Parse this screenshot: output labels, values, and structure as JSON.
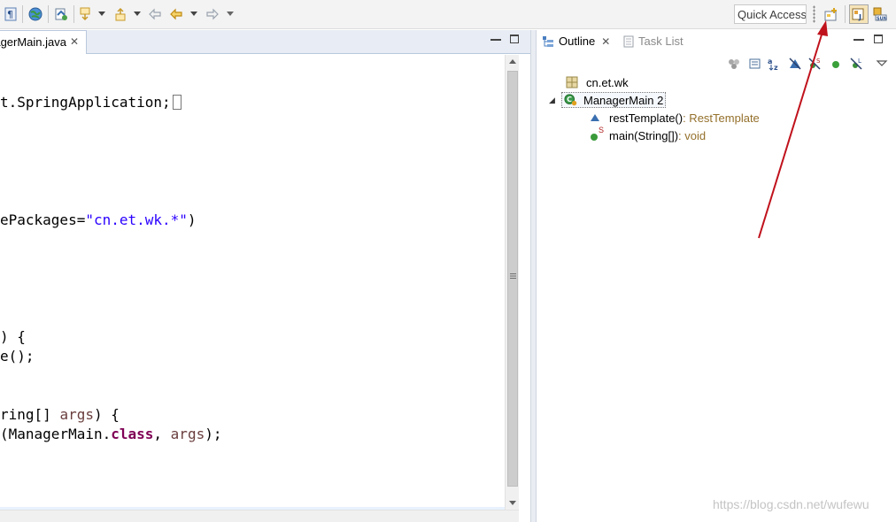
{
  "toolbar": {
    "icons": [
      "toggle-whitespace-icon",
      "globe-icon",
      "annotation-icon",
      "next-annotation-icon",
      "dropdown-icon",
      "previous-annotation-icon",
      "dropdown-icon",
      "last-edit-icon",
      "back-icon",
      "dropdown-icon",
      "forward-icon",
      "dropdown-icon"
    ],
    "quick_access": "Quick Access",
    "perspectives": [
      "open-perspective-icon",
      "java-perspective-icon",
      "java-ee-perspective-icon"
    ]
  },
  "editor": {
    "tab_label": "ManagerMain.java",
    "code": {
      "l1": "t.SpringApplication;",
      "l2_pre": "ePackages=",
      "l2_str": "\"cn.et.wk.*\"",
      "l2_post": ")",
      "l3": ") {",
      "l4": "e();",
      "l5_pre": "ring[] ",
      "l5_param": "args",
      "l5_post": ") {",
      "l6_pre": "(ManagerMain.",
      "l6_kw": "class",
      "l6_mid": ", ",
      "l6_param": "args",
      "l6_post": ");"
    }
  },
  "outline": {
    "tab_outline": "Outline",
    "tab_task_list": "Task List",
    "tree": {
      "package": "cn.et.wk",
      "class_name": "ManagerMain 2",
      "method1_name": "restTemplate()",
      "method1_type": " : RestTemplate",
      "method2_static": "S",
      "method2_name": "main(String[])",
      "method2_type": " : void"
    }
  },
  "watermark": "https://blog.csdn.net/wufewu",
  "colors": {
    "annotation_arrow": "#c0121c",
    "string": "#2a00ff",
    "keyword": "#7f0055",
    "type_label": "#94702b"
  }
}
